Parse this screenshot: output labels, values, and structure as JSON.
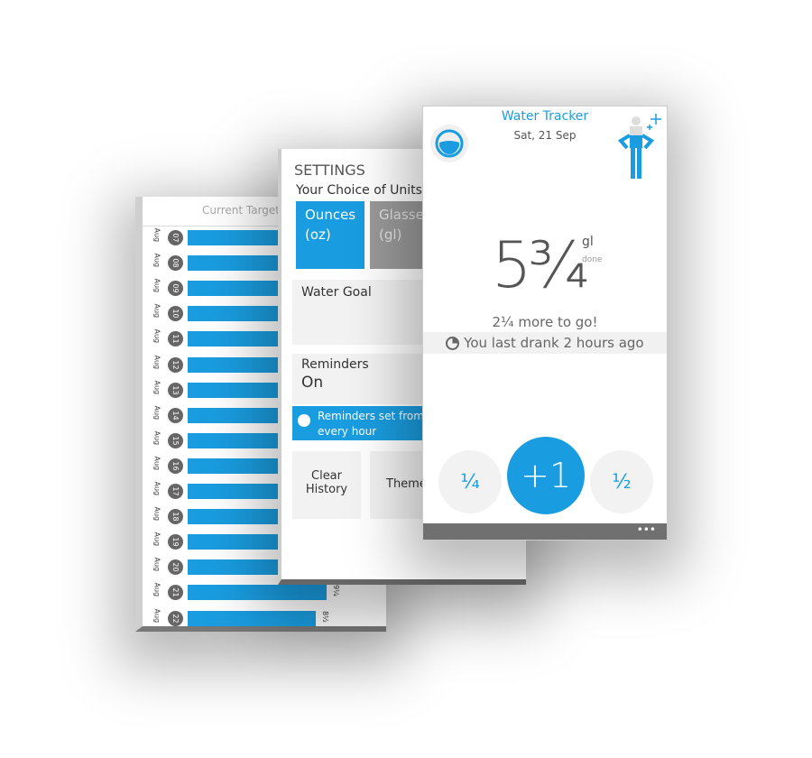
{
  "colors": {
    "accent": "#1a9de0",
    "bar_gray": "#707070"
  },
  "history": {
    "header": "Current Target",
    "month": "Aug",
    "rows": [
      {
        "day": "07",
        "value": 1.0,
        "label": ""
      },
      {
        "day": "08",
        "value": 1.0,
        "label": ""
      },
      {
        "day": "09",
        "value": 1.0,
        "label": ""
      },
      {
        "day": "10",
        "value": 1.0,
        "label": ""
      },
      {
        "day": "11",
        "value": 1.0,
        "label": ""
      },
      {
        "day": "12",
        "value": 1.0,
        "label": ""
      },
      {
        "day": "13",
        "value": 1.0,
        "label": ""
      },
      {
        "day": "14",
        "value": 1.0,
        "label": ""
      },
      {
        "day": "15",
        "value": 1.0,
        "label": ""
      },
      {
        "day": "16",
        "value": 1.0,
        "label": ""
      },
      {
        "day": "17",
        "value": 1.0,
        "label": ""
      },
      {
        "day": "18",
        "value": 1.0,
        "label": ""
      },
      {
        "day": "19",
        "value": 0.98,
        "label": ""
      },
      {
        "day": "20",
        "value": 1.0,
        "label": ""
      },
      {
        "day": "21",
        "value": 1.47,
        "label": "9¼"
      },
      {
        "day": "22",
        "value": 1.35,
        "label": "8½"
      }
    ]
  },
  "settings": {
    "title": "SETTINGS",
    "units_label": "Your Choice of Units",
    "ounces": "Ounces",
    "ounces_abbr": "(oz)",
    "glasses": "Glasses",
    "glasses_abbr": "(gl)",
    "water_goal": "Water Goal",
    "reminders": "Reminders",
    "reminders_state": "On",
    "reminders_banner_1": "Reminders set from",
    "reminders_banner_2": "every hour",
    "clear_1": "Clear",
    "clear_2": "History",
    "theme": "Theme"
  },
  "main": {
    "title": "Water Tracker",
    "date": "Sat, 21 Sep",
    "amount": "5¾",
    "unit": "gl",
    "done": "done",
    "remaining": "2¼ more to go!",
    "last_drank": "You last drank 2 hours ago",
    "quarter": "¼",
    "plus_one": "+1",
    "half": "½",
    "more": "•••"
  }
}
